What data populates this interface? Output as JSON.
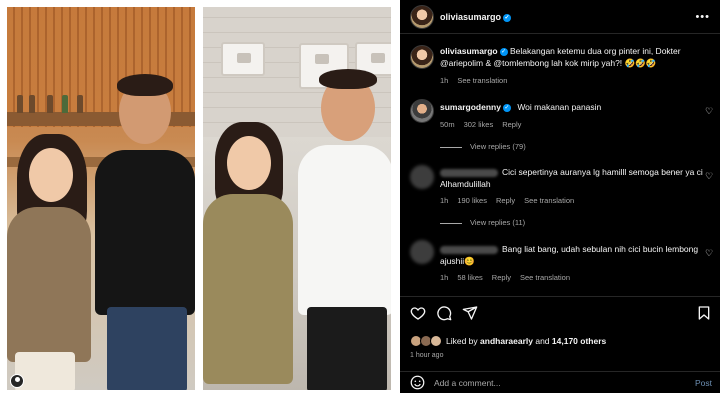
{
  "post": {
    "username": "oliviasumargo"
  },
  "caption": {
    "username": "oliviasumargo",
    "text_before": "Belakangan ketemu dua org pinter ini, Dokter",
    "mention1": "@ariepolim",
    "text_mid": " & ",
    "mention2": "@tomlembong",
    "text_after": " lah kok mirip yah?! 🤣🤣🤣",
    "age": "1h",
    "see_translation": "See translation"
  },
  "comments": [
    {
      "username": "sumargodenny",
      "text": "Woi makanan panasin",
      "age": "50m",
      "likes": "302 likes",
      "reply": "Reply",
      "view_replies": "View replies (79)"
    },
    {
      "username": "",
      "text": "Cici sepertinya auranya lg hamilll semoga bener ya ci Alhamdulillah",
      "age": "1h",
      "likes": "190 likes",
      "reply": "Reply",
      "see_translation": "See translation",
      "view_replies": "View replies (11)"
    },
    {
      "username": "",
      "text": "Bang liat bang, udah sebulan nih cici bucin lembong ajushii😊",
      "age": "1h",
      "likes": "58 likes",
      "reply": "Reply",
      "see_translation": "See translation"
    }
  ],
  "actions": {
    "liked_by_prefix": "Liked by",
    "liked_by_user": "andharaearly",
    "liked_by_and": "and",
    "liked_by_others": "14,170 others",
    "time": "1 hour ago"
  },
  "add_comment": {
    "placeholder": "Add a comment...",
    "post_label": "Post"
  },
  "icons": [
    "more-icon",
    "heart-icon",
    "comment-icon",
    "share-icon",
    "bookmark-icon",
    "emoji-icon",
    "verified-icon",
    "user-tag-icon"
  ],
  "colors": {
    "panel_bg": "#000000",
    "text": "#f5f5f5",
    "secondary": "#a8a8a8",
    "verified": "#0095f6",
    "post_link": "#6d8fb3"
  }
}
